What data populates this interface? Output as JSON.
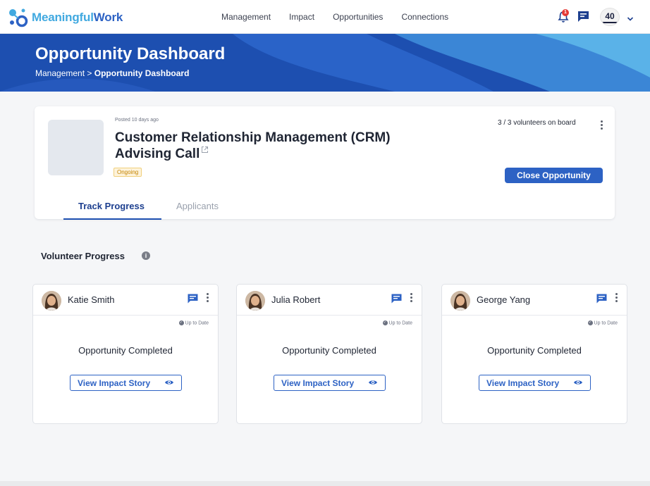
{
  "brand": {
    "name_part1": "Meaningful",
    "name_part2": "Work"
  },
  "nav": {
    "links": [
      "Management",
      "Impact",
      "Opportunities",
      "Connections"
    ],
    "notification_count": "1",
    "org_logo_text": "40"
  },
  "hero": {
    "title": "Opportunity Dashboard",
    "breadcrumb": {
      "parent": "Management",
      "separator": ">",
      "current": "Opportunity Dashboard"
    }
  },
  "opportunity": {
    "posted": "Posted 10 days ago",
    "title": "Customer Relationship Management (CRM) Advising Call",
    "status": "Ongoing",
    "volunteers": "3 / 3 volunteers on board",
    "close_label": "Close Opportunity",
    "tabs": [
      {
        "label": "Track Progress",
        "active": true
      },
      {
        "label": "Applicants",
        "active": false
      }
    ]
  },
  "progress": {
    "title": "Volunteer Progress",
    "info_icon": "i",
    "volunteers": [
      {
        "name": "Katie Smith",
        "state": "Up to Date",
        "status": "Opportunity Completed",
        "action": "View Impact Story"
      },
      {
        "name": "Julia Robert",
        "state": "Up to Date",
        "status": "Opportunity Completed",
        "action": "View Impact Story"
      },
      {
        "name": "George Yang",
        "state": "Up to Date",
        "status": "Opportunity Completed",
        "action": "View Impact Story"
      }
    ]
  },
  "colors": {
    "primary": "#2d62c4",
    "hero": "#1d4fb0",
    "accent": "#41a9e0"
  }
}
